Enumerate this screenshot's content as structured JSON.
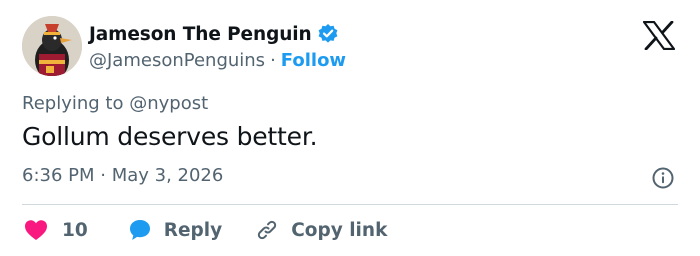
{
  "author": {
    "display_name": "Jameson The Penguin",
    "handle": "@JamesonPenguins",
    "separator": "·",
    "follow_label": "Follow",
    "verified": true
  },
  "icons": {
    "verified": "verified-badge-icon",
    "brand": "x-logo-icon",
    "info": "info-icon",
    "like": "heart-icon",
    "reply": "speech-bubble-icon",
    "copy": "link-icon"
  },
  "colors": {
    "accent": "#1d9bf0",
    "like": "#f91880",
    "text": "#0f1419",
    "muted": "#536471",
    "divider": "#cfd9de"
  },
  "tweet": {
    "replying_prefix": "Replying to",
    "replying_to": "@nypost",
    "text": "Gollum deserves better.",
    "timestamp": "6:36 PM · May 3, 2026"
  },
  "actions": {
    "like_count": "10",
    "reply_label": "Reply",
    "copy_label": "Copy link"
  }
}
